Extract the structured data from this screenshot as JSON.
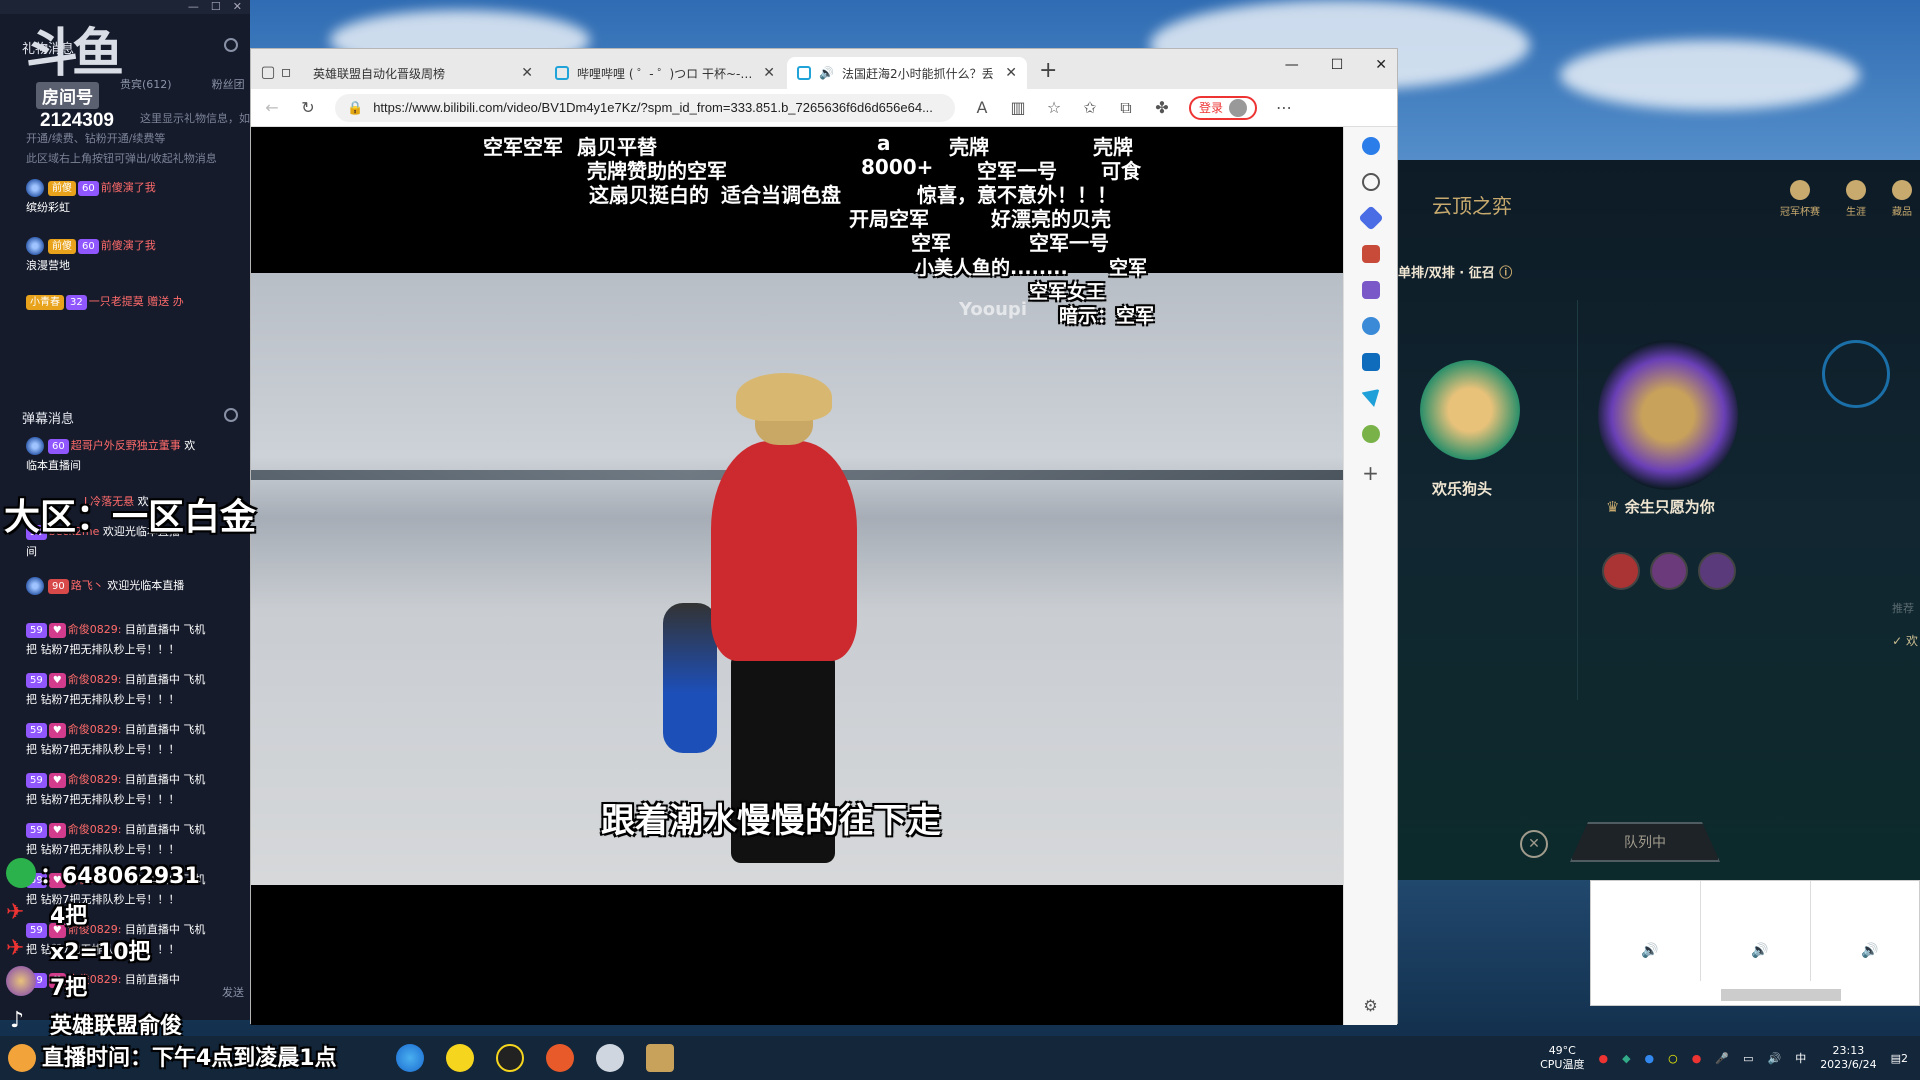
{
  "chat": {
    "gift_header": "礼物消息",
    "logo_text": "斗鱼",
    "room_tag": "房间号",
    "room_number": "2124309",
    "gift_tabs": [
      "贵宾(612)",
      "粉丝团"
    ],
    "notice_lines": [
      "这里显示礼物信息，如礼物、道具、贵",
      "开通/续费、钻粉开通/续费等",
      "此区域右上角按钮可弹出/收起礼物消息"
    ],
    "gift_rows": [
      {
        "badge1": "前傻",
        "badge2": "60",
        "text": "前傻演了我",
        "user": "缤纷彩虹"
      },
      {
        "badge1": "前傻",
        "badge2": "60",
        "text": "前傻演了我",
        "user": "浪漫营地"
      },
      {
        "badge1": "小青春",
        "badge2": "32",
        "text": "一只老提莫 赠送 办"
      }
    ],
    "danmaku_header": "弹幕消息",
    "dm_rows": [
      {
        "lv": "60",
        "user": "超哥户外反野独立董事",
        "msg": "欢",
        "cont": "临本直播间"
      },
      {
        "lv": "50",
        "user": "L冷落无悬",
        "msg": "欢"
      },
      {
        "lv": "50",
        "user": "beck2me",
        "msg": "欢迎光临本直播",
        "cont": "间"
      },
      {
        "lv": "90",
        "user": "路飞丶",
        "msg": "欢迎光临本直播"
      }
    ],
    "spam_rows": [
      {
        "lv": "59",
        "user": "俞俊0829:",
        "msg": "目前直播中 飞机",
        "cont": "把 钻粉7把无排队秒上号！！！"
      },
      {
        "lv": "59",
        "user": "俞俊0829:",
        "msg": "目前直播中 飞机",
        "cont": "把 钻粉7把无排队秒上号！！！"
      },
      {
        "lv": "59",
        "user": "俞俊0829:",
        "msg": "目前直播中 飞机",
        "cont": "把 钻粉7把无排队秒上号！！！"
      },
      {
        "lv": "59",
        "user": "俞俊0829:",
        "msg": "目前直播中 飞机",
        "cont": "把 钻粉7把无排队秒上号！！！"
      },
      {
        "lv": "59",
        "user": "俞俊0829:",
        "msg": "目前直播中 飞机",
        "cont": "把 钻粉7把无排队秒上号！！！"
      },
      {
        "lv": "59",
        "user": "俞俊0829:",
        "msg": "目前直播中 飞机",
        "cont": "把 钻粉7把无排队秒上号！！！"
      },
      {
        "lv": "59",
        "user": "俞俊0829:",
        "msg": "目前直播中 飞机",
        "cont": "把 钻粉7把无排队秒上号！！！"
      },
      {
        "lv": "59",
        "user": "俞俊0829:",
        "msg": "目前直播中"
      }
    ],
    "send_label": "发送"
  },
  "overlays": {
    "region": "大区：一区白金",
    "wechat": "：648062931",
    "plane1": "4把",
    "plane2": "x2=10把",
    "plane3": "7把",
    "streamer": "英雄联盟俞俊",
    "live_time": "直播时间：下午4点到凌晨1点"
  },
  "browser": {
    "tabs": [
      {
        "label": "英雄联盟自动化晋级周榜"
      },
      {
        "label": "哔哩哔哩 ( ゜- ゜)つロ 干杯~-bili"
      },
      {
        "label": "法国赶海2小时能抓什么？丢"
      }
    ],
    "url": "https://www.bilibili.com/video/BV1Dm4y1e7Kz/?spm_id_from=333.851.b_7265636f6d6d656e64...",
    "login_label": "登录"
  },
  "video": {
    "danmaku": [
      "空军空军",
      "扇贝平替",
      "a",
      "壳牌",
      "壳牌",
      "壳牌赞助的空军",
      "8000+",
      "空军一号",
      "可食",
      "这扇贝挺白的",
      "适合当调色盘",
      "惊喜，意不意外！！！",
      "开局空军",
      "好漂亮的贝壳",
      "空军",
      "空军一号",
      "小美人鱼的........",
      "空军",
      "空军女王",
      "暗示：空军"
    ],
    "watermark": "Yooupi",
    "subtitle": "跟着潮水慢慢的往下走"
  },
  "lol": {
    "title": "云顶之弈",
    "nav": [
      "冠军杯赛",
      "生涯",
      "藏品"
    ],
    "queue_type": "单排/双排 · 征召",
    "player1": "欢乐狗头",
    "player2": "余生只愿为你",
    "queue_button": "队列中",
    "side_label": "推荐",
    "check_label": "欢"
  },
  "taskbar": {
    "temp": "49°C",
    "temp_label": "CPU温度",
    "time": "23:13",
    "date": "2023/6/24",
    "ime": "中",
    "notif": "2"
  }
}
